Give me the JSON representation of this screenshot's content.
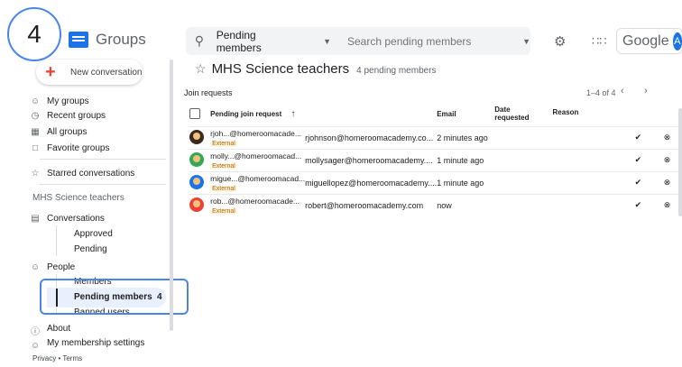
{
  "step_number": "4",
  "header": {
    "app_name": "Groups",
    "search_scope": "Pending members",
    "search_placeholder": "Search pending members",
    "google_text": "Google",
    "account_initial": "A"
  },
  "sidebar": {
    "new_conversation": "New conversation",
    "nav": [
      "My groups",
      "Recent groups",
      "All groups",
      "Favorite groups"
    ],
    "starred": "Starred conversations",
    "group_name": "MHS Science teachers",
    "conversations": "Conversations",
    "conversation_sub": [
      "Approved",
      "Pending"
    ],
    "people": "People",
    "members": "Members",
    "pending_members": "Pending members",
    "pending_count": "4",
    "banned_users": "Banned users",
    "about": "About",
    "membership_settings": "My membership settings",
    "footer": "Privacy • Terms"
  },
  "main": {
    "group_title": "MHS Science teachers",
    "pending_summary": "4 pending members",
    "section_title": "Join requests",
    "pagination": "1–4 of 4",
    "columns": {
      "request": "Pending join request",
      "email": "Email",
      "date": "Date requested",
      "reason": "Reason"
    },
    "rows": [
      {
        "name": "rjoh...@homeroomacade...",
        "badge": "External",
        "email": "rjohnson@homeroomacademy.co...",
        "date": "2 minutes ago",
        "avatar_color": "#3c2a1e"
      },
      {
        "name": "molly...@homeroomacad...",
        "badge": "External",
        "email": "mollysager@homeroomacademy....",
        "date": "1 minute ago",
        "avatar_color": "#34a853"
      },
      {
        "name": "migue...@homeroomacad...",
        "badge": "External",
        "email": "miguellopez@homeroomacademy....",
        "date": "1 minute ago",
        "avatar_color": "#1a73e8"
      },
      {
        "name": "rob...@homeroomacade...",
        "badge": "External",
        "email": "robert@homeroomacademy.com",
        "date": "now",
        "avatar_color": "#ea4335"
      }
    ]
  },
  "icons": {
    "search": "search-icon",
    "settings": "gear-icon",
    "apps": "apps-grid-icon",
    "approve": "check-circle-icon",
    "reject": "x-circle-icon"
  },
  "colors": {
    "accent": "#1a73e8",
    "highlight": "#4a86e8",
    "external_badge_bg": "#fef7e0",
    "external_badge_text": "#b06000",
    "active_nav_bg": "#e8f0fe"
  }
}
